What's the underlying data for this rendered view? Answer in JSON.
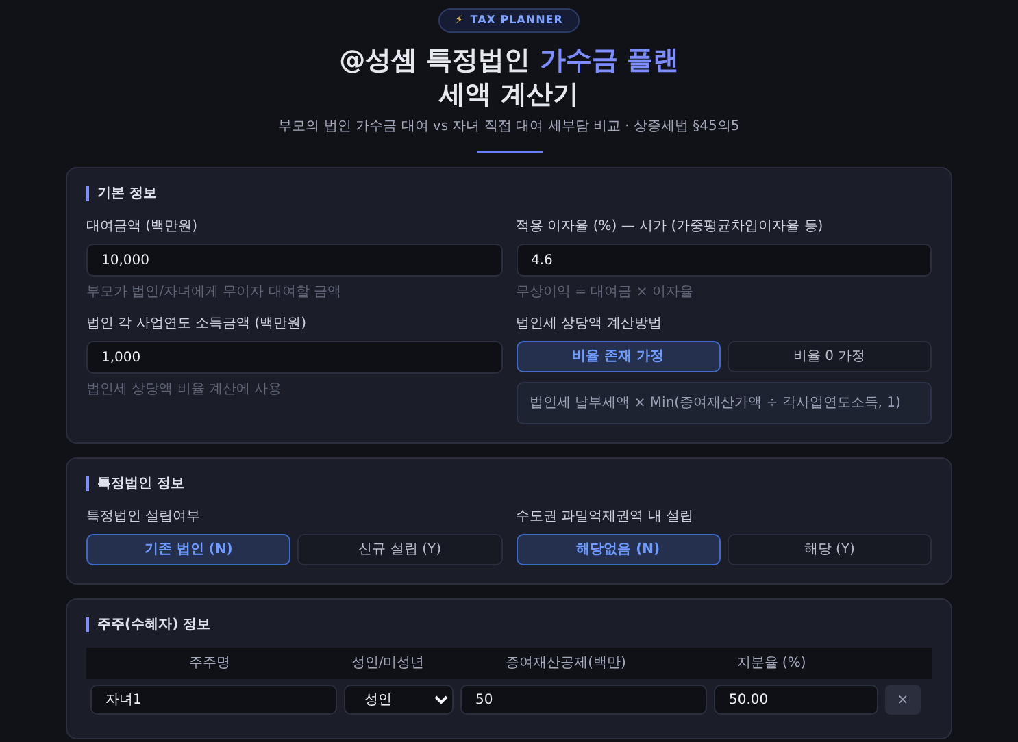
{
  "header": {
    "badge": {
      "icon": "⚡",
      "text": "TAX PLANNER"
    },
    "title": {
      "plain": "@성셈 특정법인 ",
      "accent": "가수금 플랜",
      "line2": "세액 계산기"
    },
    "subtitle": "부모의 법인 가수금 대여 vs 자녀 직접 대여 세부담 비교 · 상증세법 §45의5"
  },
  "sections": [
    {
      "title": "기본 정보",
      "fields": [
        {
          "kind": "input",
          "label": "대여금액 (백만원)",
          "value": "10,000",
          "help": "부모가 법인/자녀에게 무이자 대여할 금액"
        },
        {
          "kind": "input",
          "label": "적용 이자율 (%) — 시가 (가중평균차입이자율 등)",
          "value": "4.6",
          "help": "무상이익 = 대여금 × 이자율"
        },
        {
          "kind": "input",
          "label": "법인 각 사업연도 소득금액 (백만원)",
          "value": "1,000",
          "help": "법인세 상당액 비율 계산에 사용"
        },
        {
          "kind": "toggle",
          "label": "법인세 상당액 계산방법",
          "options": [
            {
              "label": "비율 존재 가정",
              "selected": true
            },
            {
              "label": "비율 0 가정",
              "selected": false
            }
          ],
          "note": "법인세 납부세액 × Min(증여재산가액 ÷ 각사업연도소득, 1)"
        }
      ]
    },
    {
      "title": "특정법인 정보",
      "fields": [
        {
          "kind": "toggle",
          "label": "특정법인 설립여부",
          "options": [
            {
              "label": "기존 법인 (N)",
              "selected": true
            },
            {
              "label": "신규 설립 (Y)",
              "selected": false
            }
          ]
        },
        {
          "kind": "toggle",
          "label": "수도권 과밀억제권역 내 설립",
          "options": [
            {
              "label": "해당없음 (N)",
              "selected": true
            },
            {
              "label": "해당 (Y)",
              "selected": false
            }
          ]
        }
      ]
    },
    {
      "title": "주주(수혜자) 정보",
      "table": {
        "columns": [
          "주주명",
          "성인/미성년",
          "증여재산공제(백만)",
          "지분율 (%)"
        ],
        "rows": [
          {
            "name": "자녀1",
            "type": "성인",
            "deduction": "50",
            "share": "50.00",
            "remove": "×"
          }
        ]
      }
    }
  ]
}
